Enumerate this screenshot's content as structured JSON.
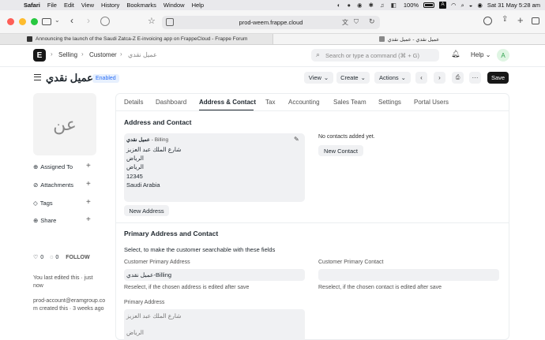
{
  "menubar": {
    "apple": "",
    "app": "Safari",
    "items": [
      "File",
      "Edit",
      "View",
      "History",
      "Bookmarks",
      "Window",
      "Help"
    ],
    "battery": "100%",
    "input_label": "A",
    "datetime": "Sat 31 May  5:28 am"
  },
  "browser": {
    "address": "prod-weem.frappe.cloud",
    "tabs": [
      {
        "title": "Announcing the launch of the Saudi Zatca-Z E-invoicing app on FrappeCloud - Frappe Forum"
      },
      {
        "title": "عميل نقدي - عميل نقدي"
      }
    ]
  },
  "navbar": {
    "logo": "E",
    "breadcrumbs": [
      "Selling",
      "Customer",
      "عميل نقدي"
    ],
    "search_placeholder": "Search or type a command (⌘ + G)",
    "help_label": "Help",
    "avatar": "A"
  },
  "page": {
    "title": "عميل نقدي",
    "status": "Enabled",
    "view_label": "View",
    "create_label": "Create",
    "actions_label": "Actions",
    "save_label": "Save"
  },
  "sidebar": {
    "avatar_text": "عن",
    "items": [
      {
        "label": "Assigned To"
      },
      {
        "label": "Attachments"
      },
      {
        "label": "Tags"
      },
      {
        "label": "Share"
      }
    ],
    "likes": "0",
    "comments": "0",
    "follow": "FOLLOW",
    "edited": "You last edited this · just now",
    "created": "prod-account@eramgroup.com created this · 3 weeks ago"
  },
  "tabs": [
    "Details",
    "Dashboard",
    "Address & Contact",
    "Tax",
    "Accounting",
    "Sales Team",
    "Settings",
    "Portal Users"
  ],
  "address_section": {
    "title": "Address and Contact",
    "card_title": "عميل نقدي",
    "card_tag": "- Billing",
    "lines": [
      "شارع الملك عبد العزيز",
      "الرياض",
      "الرياض",
      "12345",
      "Saudi Arabia"
    ],
    "new_address": "New Address",
    "no_contacts": "No contacts added yet.",
    "new_contact": "New Contact"
  },
  "primary_section": {
    "title": "Primary Address and Contact",
    "subtitle": "Select, to make the customer searchable with these fields",
    "cust_addr_label": "Customer Primary Address",
    "cust_addr_value": "عميل نقدي-Billing",
    "cust_addr_help": "Reselect, if the chosen address is edited after save",
    "cust_contact_label": "Customer Primary Contact",
    "cust_contact_help": "Reselect, if the chosen contact is edited after save",
    "primary_addr_label": "Primary Address",
    "primary_addr_lines": [
      "شارع الملك عبد العزيز",
      "الرياض"
    ]
  }
}
